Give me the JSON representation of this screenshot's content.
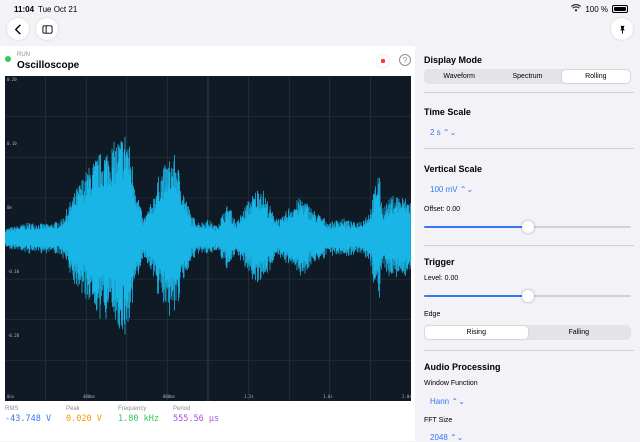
{
  "status": {
    "time": "11:04",
    "date": "Tue Oct 21",
    "battery": "100 %"
  },
  "header": {
    "run_label": "RUN",
    "title": "Oscilloscope"
  },
  "scope": {
    "y_labels": [
      "0.20",
      "0.10",
      "0m",
      "-0.10",
      "-0.20"
    ],
    "x_labels": [
      "0ns",
      "400ms",
      "800ms",
      "1.2s",
      "1.6s",
      "2.0s"
    ]
  },
  "stats": {
    "rms": {
      "label": "RMS",
      "value": "-43.748 V",
      "color": "#3478f6"
    },
    "peak": {
      "label": "Peak",
      "value": "0.020 V",
      "color": "#ff9500"
    },
    "frequency": {
      "label": "Frequency",
      "value": "1.80 kHz",
      "color": "#34c759"
    },
    "period": {
      "label": "Period",
      "value": "555.56 µs",
      "color": "#af52de"
    }
  },
  "display_mode": {
    "title": "Display Mode",
    "options": [
      "Waveform",
      "Spectrum",
      "Rolling"
    ],
    "selected": 2
  },
  "time_scale": {
    "title": "Time Scale",
    "value": "2 s"
  },
  "vertical_scale": {
    "title": "Vertical Scale",
    "value": "100 mV",
    "offset_label": "Offset: 0.00",
    "offset_fraction": 0.5
  },
  "trigger": {
    "title": "Trigger",
    "level_label": "Level: 0.00",
    "level_fraction": 0.5,
    "edge_label": "Edge",
    "edge_options": [
      "Rising",
      "Falling"
    ],
    "edge_selected": 0
  },
  "audio": {
    "title": "Audio Processing",
    "window_label": "Window Function",
    "window_value": "Hann",
    "fft_label": "FFT Size",
    "fft_value": "2048"
  },
  "colors": {
    "wave": "#19b5e6",
    "accent": "#3478f6"
  }
}
